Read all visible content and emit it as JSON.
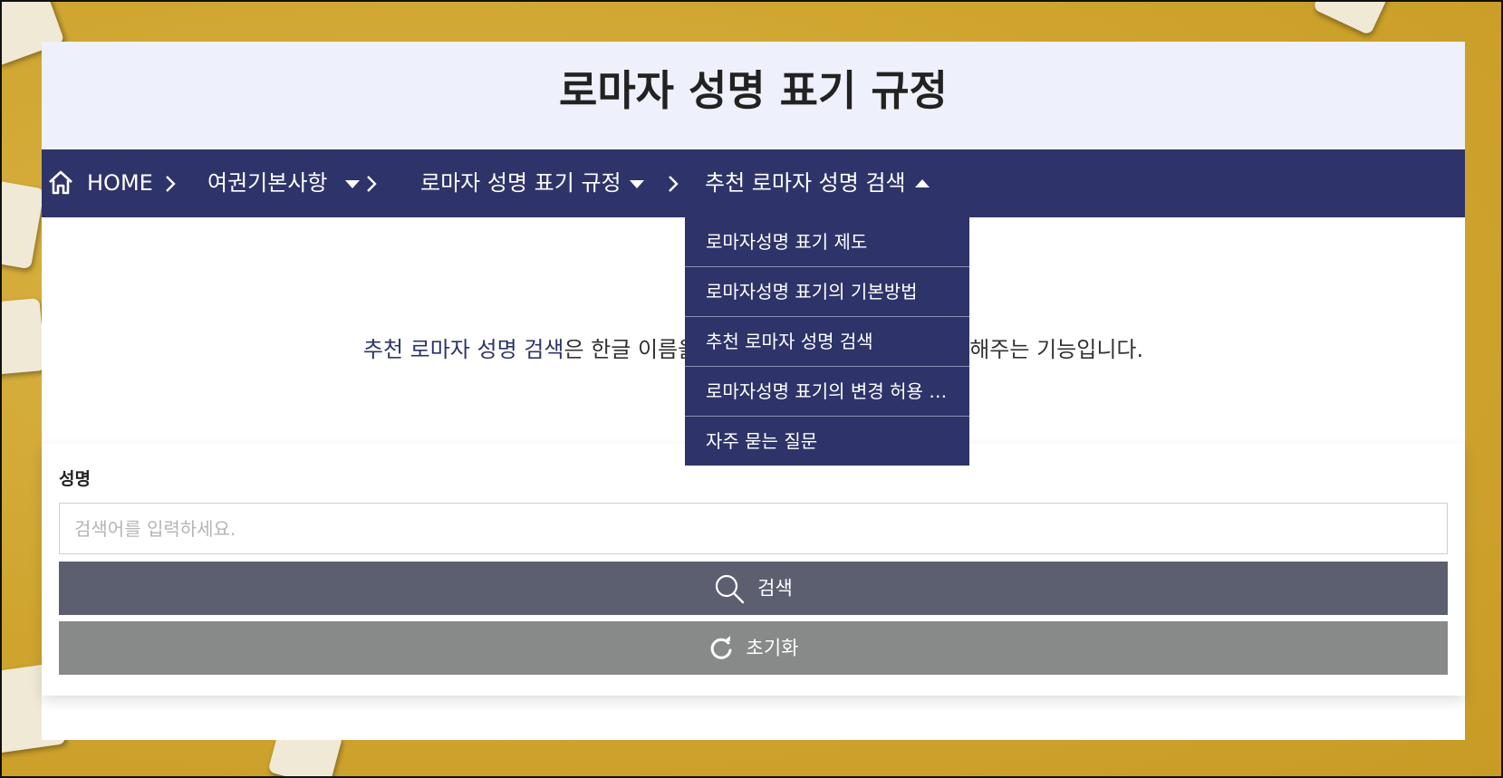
{
  "page": {
    "title": "로마자 성명 표기 규정"
  },
  "breadcrumb": {
    "home_label": "HOME",
    "level1_label": "여권기본사항",
    "level2_label": "로마자 성명 표기 규정",
    "level3_label": "추천 로마자 성명 검색"
  },
  "dropdown": {
    "items": [
      "로마자성명 표기 제도",
      "로마자성명 표기의 기본방법",
      "추천 로마자 성명 검색",
      "로마자성명 표기의 변경 허용 및 제한",
      "자주 묻는 질문"
    ]
  },
  "intro": {
    "highlight": "추천 로마자 성명 검색",
    "text_before_gap": "은 한글 이름을",
    "text_after_gap": "해주는 기능입니다."
  },
  "search_form": {
    "label": "성명",
    "placeholder": "검색어를 입력하세요.",
    "value": "",
    "search_button": "검색",
    "reset_button": "초기화"
  },
  "colors": {
    "nav_bg": "#2e3469",
    "banner_bg": "#eef0fb",
    "search_btn": "#5c5f70",
    "reset_btn": "#888989"
  }
}
